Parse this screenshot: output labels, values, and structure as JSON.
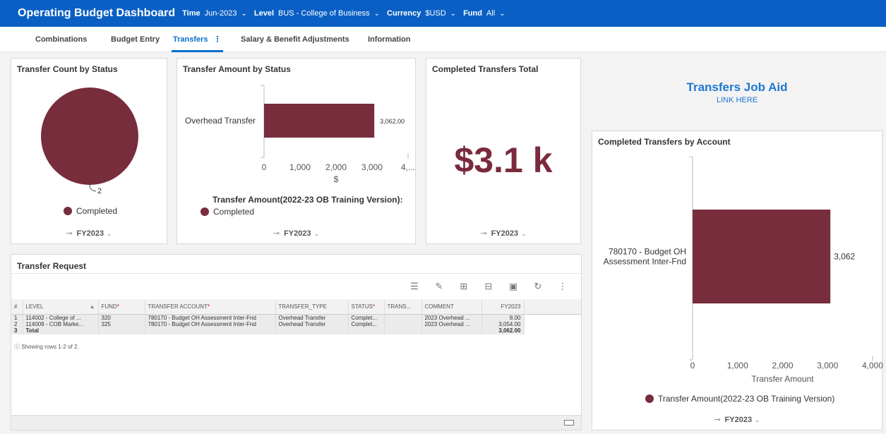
{
  "header": {
    "title": "Operating Budget Dashboard",
    "filters": [
      {
        "label": "Time",
        "value": "Jun-2023"
      },
      {
        "label": "Level",
        "value": "BUS - College of Business"
      },
      {
        "label": "Currency",
        "value": "$USD"
      },
      {
        "label": "Fund",
        "value": "All"
      }
    ]
  },
  "tabs": [
    {
      "label": "Combinations",
      "active": false
    },
    {
      "label": "Budget Entry",
      "active": false
    },
    {
      "label": "Transfers",
      "active": true
    },
    {
      "label": "Salary & Benefit Adjustments",
      "active": false
    },
    {
      "label": "Information",
      "active": false
    }
  ],
  "cards": {
    "transfer_count": {
      "title": "Transfer Count by Status",
      "legend": "Completed",
      "footer": "FY2023"
    },
    "transfer_amount": {
      "title": "Transfer Amount by Status",
      "legend_title": "Transfer Amount(2022-23 OB Training Version):",
      "legend": "Completed",
      "footer": "FY2023"
    },
    "completed_total": {
      "title": "Completed Transfers Total",
      "kpi": "$3.1 k",
      "footer": "FY2023"
    },
    "by_account": {
      "title": "Completed Transfers by Account",
      "legend": "Transfer Amount(2022-23 OB Training Version)",
      "footer": "FY2023"
    },
    "transfer_request": {
      "title": "Transfer Request",
      "row_info": "Showing rows 1-2 of 2."
    }
  },
  "job_aid": {
    "title": "Transfers Job Aid",
    "link": "LINK HERE"
  },
  "table": {
    "columns": [
      "#",
      "LEVEL",
      "FUND",
      "TRANSFER ACCOUNT",
      "TRANSFER_TYPE",
      "STATUS",
      "TRANS...",
      "COMMENT",
      "FY2023"
    ],
    "rows": [
      [
        "1",
        "114002 - College of ...",
        "320",
        "780170 - Budget OH Assessment Inter-Fnd",
        "Overhead Transfer",
        "Complet...",
        "",
        "2023 Overhead ...",
        "8.00"
      ],
      [
        "2",
        "114009 - COB Marke...",
        "325",
        "780170 - Budget OH Assessment Inter-Fnd",
        "Overhead Transfer",
        "Complet...",
        "",
        "2023 Overhead ...",
        "3,054.00"
      ],
      [
        "3",
        "Total",
        "",
        "",
        "",
        "",
        "",
        "",
        "3,062.00"
      ]
    ]
  },
  "colors": {
    "brand": "#0a5fc4",
    "series": "#772d3c",
    "accent": "#0a6ed1"
  },
  "chart_data": [
    {
      "type": "pie",
      "title": "Transfer Count by Status",
      "categories": [
        "Completed"
      ],
      "values": [
        2
      ],
      "data_labels": [
        "2"
      ]
    },
    {
      "type": "bar",
      "orientation": "horizontal",
      "title": "Transfer Amount by Status",
      "categories": [
        "Overhead Transfer"
      ],
      "values": [
        3062
      ],
      "data_labels": [
        "3,062.00"
      ],
      "xlabel": "$",
      "x_ticks": [
        "0",
        "1,000",
        "2,000",
        "3,000",
        "4,..."
      ],
      "xlim": [
        0,
        4000
      ],
      "legend": "Completed"
    },
    {
      "type": "bar",
      "orientation": "horizontal",
      "title": "Completed Transfers by Account",
      "categories": [
        "780170 - Budget OH Assessment Inter-Fnd"
      ],
      "values": [
        3062
      ],
      "data_labels": [
        "3,062"
      ],
      "xlabel": "Transfer Amount",
      "x_ticks": [
        "0",
        "1,000",
        "2,000",
        "3,000",
        "4,000"
      ],
      "xlim": [
        0,
        4000
      ],
      "legend": "Transfer Amount(2022-23 OB Training Version)"
    }
  ]
}
